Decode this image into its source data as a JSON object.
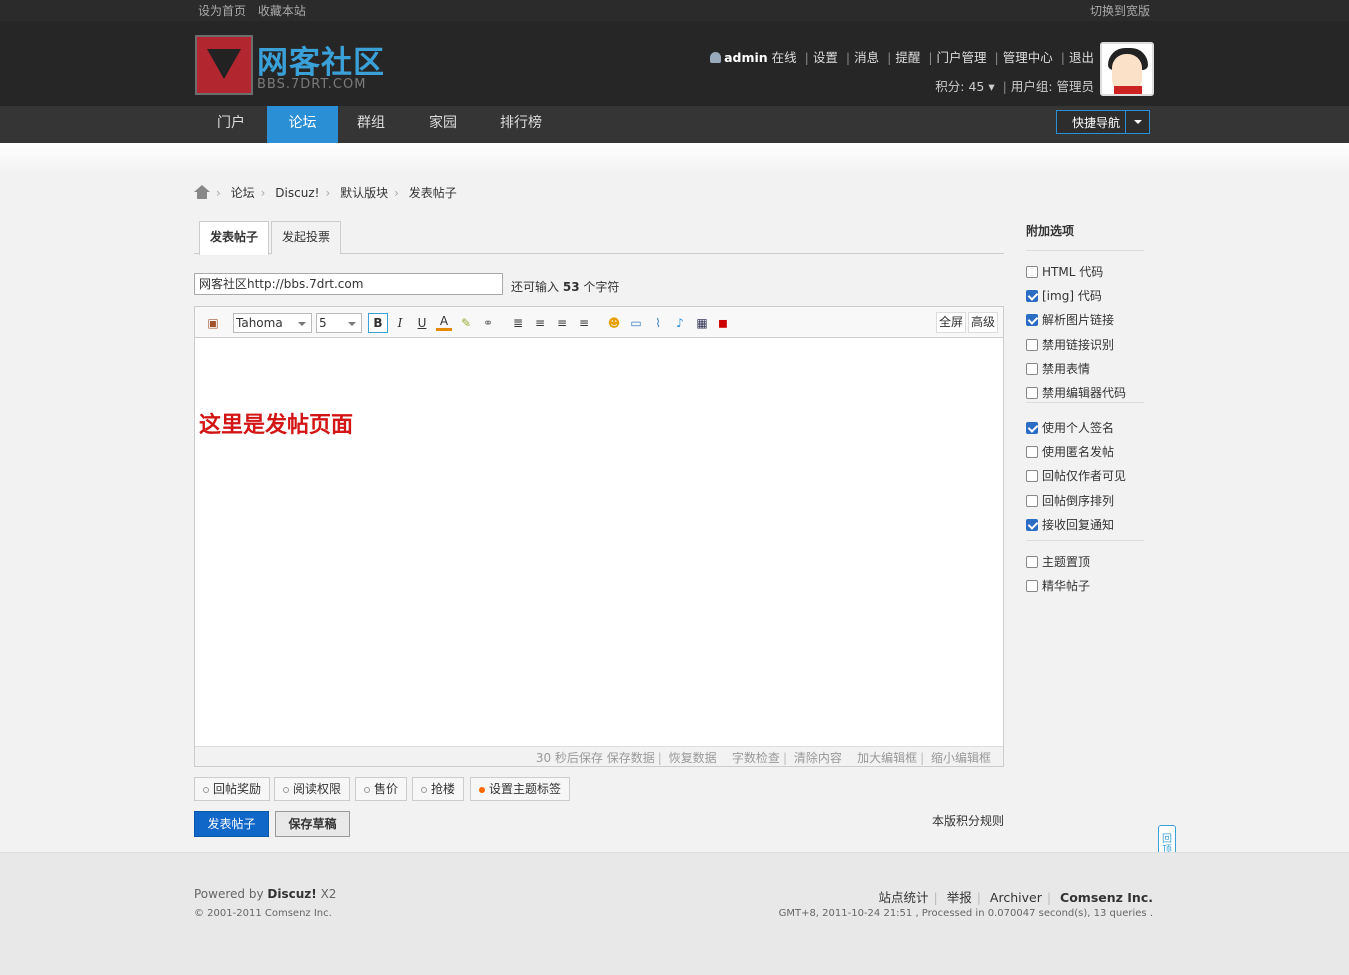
{
  "topbar": {
    "set_home": "设为首页",
    "bookmark": "收藏本站",
    "switch_wide": "切换到宽版"
  },
  "logo": {
    "title": "网客社区",
    "domain": "BBS.7DRT.COM"
  },
  "user": {
    "name": "admin",
    "status": "在线",
    "links": [
      "设置",
      "消息",
      "提醒",
      "门户管理",
      "管理中心",
      "退出"
    ],
    "score": "积分: 45",
    "group": "用户组: 管理员"
  },
  "nav": {
    "items": [
      "门户",
      "论坛",
      "群组",
      "家园",
      "排行榜"
    ],
    "active": "论坛",
    "quick": "快捷导航"
  },
  "breadcrumb": [
    "论坛",
    "Discuz!",
    "默认版块",
    "发表帖子"
  ],
  "tabs": [
    "发表帖子",
    "发起投票"
  ],
  "subject": {
    "value": "网客社区http://bbs.7drt.com",
    "remain_prefix": "还可输入",
    "remain_count": "53",
    "remain_suffix": "个字符"
  },
  "toolbar": {
    "font": "Tahoma",
    "size": "5",
    "fullscreen": "全屏",
    "advanced": "高级"
  },
  "editor_content": "这里是发帖页面",
  "editor_footer": [
    "30 秒后保存",
    "保存数据",
    "恢复数据",
    "字数检查",
    "清除内容",
    "加大编辑框",
    "缩小编辑框"
  ],
  "extras": [
    "回帖奖励",
    "阅读权限",
    "售价",
    "抢楼",
    "设置主题标签"
  ],
  "buttons": {
    "post": "发表帖子",
    "draft": "保存草稿",
    "rules": "本版积分规则"
  },
  "sidebar": {
    "title": "附加选项",
    "group1": [
      {
        "label": "HTML 代码",
        "checked": false
      },
      {
        "label": "[img] 代码",
        "checked": true
      },
      {
        "label": "解析图片链接",
        "checked": true
      },
      {
        "label": "禁用链接识别",
        "checked": false
      },
      {
        "label": "禁用表情",
        "checked": false
      },
      {
        "label": "禁用编辑器代码",
        "checked": false
      }
    ],
    "group2": [
      {
        "label": "使用个人签名",
        "checked": true
      },
      {
        "label": "使用匿名发帖",
        "checked": false
      },
      {
        "label": "回帖仅作者可见",
        "checked": false
      },
      {
        "label": "回帖倒序排列",
        "checked": false
      },
      {
        "label": "接收回复通知",
        "checked": true
      }
    ],
    "group3": [
      {
        "label": "主题置顶",
        "checked": false
      },
      {
        "label": "精华帖子",
        "checked": false
      }
    ]
  },
  "totop": "回顶部",
  "footer": {
    "powered_prefix": "Powered by",
    "powered_name": "Discuz!",
    "powered_ver": "X2",
    "copyright": "© 2001-2011 Comsenz Inc.",
    "links": [
      "站点统计",
      "举报",
      "Archiver"
    ],
    "company": "Comsenz Inc.",
    "stats": "GMT+8, 2011-10-24 21:51 , Processed in 0.070047 second(s), 13 queries ."
  }
}
